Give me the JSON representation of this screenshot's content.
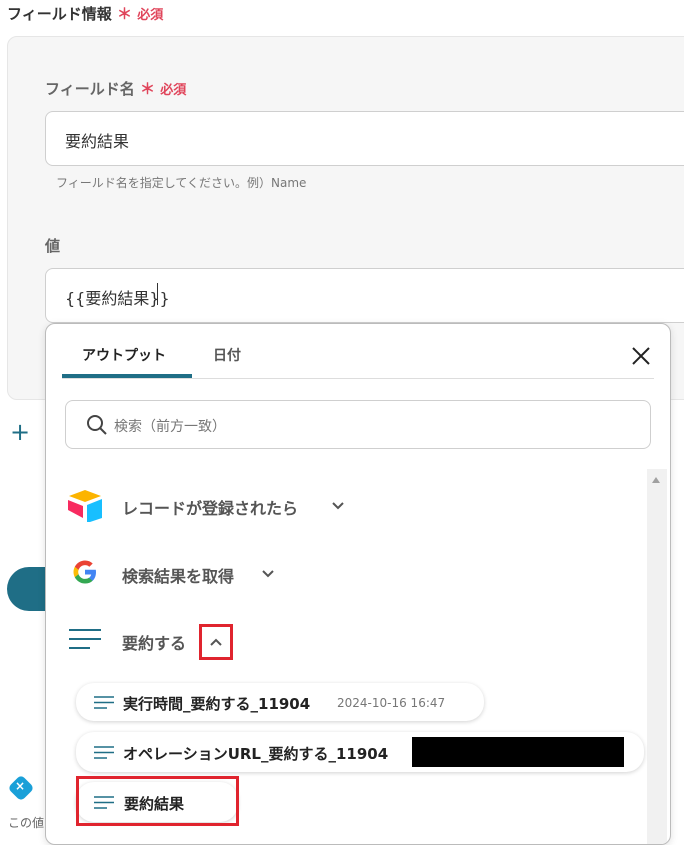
{
  "section": {
    "title": "フィールド情報",
    "required_mark": "＊",
    "required_text": "必須"
  },
  "field_name": {
    "label": "フィールド名",
    "required_mark": "＊",
    "required_text": "必須",
    "value": "要約結果",
    "hint": "フィールド名を指定してください。例）Name"
  },
  "value_field": {
    "label": "値",
    "value": "{{要約結果}}"
  },
  "dropdown": {
    "tabs": [
      {
        "label": "アウトプット",
        "active": true
      },
      {
        "label": "日付",
        "active": false
      }
    ],
    "search_placeholder": "検索（前方一致）",
    "groups": [
      {
        "label": "レコードが登録されたら",
        "icon": "airtable-logo-icon",
        "expanded": false
      },
      {
        "label": "検索結果を取得",
        "icon": "google-logo-icon",
        "expanded": false
      },
      {
        "label": "要約する",
        "icon": "lines-icon",
        "expanded": true
      }
    ],
    "items": [
      {
        "label": "実行時間_要約する_11904",
        "meta": "2024-10-16 16:47"
      },
      {
        "label": "オペレーションURL_要約する_11904",
        "meta": ""
      },
      {
        "label": "要約結果",
        "meta": ""
      }
    ]
  },
  "bottom": {
    "text": "この値"
  },
  "colors": {
    "accent": "#1f6e86",
    "required": "#e0455b",
    "highlight": "#e0242e"
  }
}
